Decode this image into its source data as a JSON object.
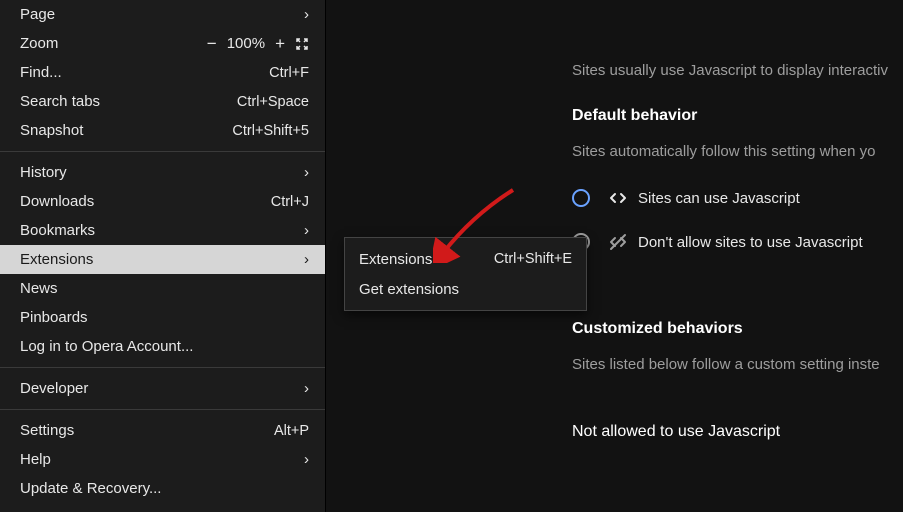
{
  "menu": {
    "page": {
      "label": "Page"
    },
    "zoom": {
      "label": "Zoom",
      "minus": "−",
      "value": "100%",
      "plus": "+"
    },
    "find": {
      "label": "Find...",
      "shortcut": "Ctrl+F"
    },
    "searchTabs": {
      "label": "Search tabs",
      "shortcut": "Ctrl+Space"
    },
    "snapshot": {
      "label": "Snapshot",
      "shortcut": "Ctrl+Shift+5"
    },
    "history": {
      "label": "History"
    },
    "downloads": {
      "label": "Downloads",
      "shortcut": "Ctrl+J"
    },
    "bookmarks": {
      "label": "Bookmarks"
    },
    "extensions": {
      "label": "Extensions"
    },
    "news": {
      "label": "News"
    },
    "pinboards": {
      "label": "Pinboards"
    },
    "login": {
      "label": "Log in to Opera Account..."
    },
    "developer": {
      "label": "Developer"
    },
    "settings": {
      "label": "Settings",
      "shortcut": "Alt+P"
    },
    "help": {
      "label": "Help"
    },
    "update": {
      "label": "Update & Recovery..."
    }
  },
  "submenu": {
    "extensions": {
      "label": "Extensions",
      "shortcut": "Ctrl+Shift+E"
    },
    "getExtensions": {
      "label": "Get extensions"
    }
  },
  "content": {
    "introDesc": "Sites usually use Javascript to display interactiv",
    "defaultBehaviorTitle": "Default behavior",
    "defaultBehaviorDesc": "Sites automatically follow this setting when yo",
    "optionAllow": "Sites can use Javascript",
    "optionDeny": "Don't allow sites to use Javascript",
    "customTitle": "Customized behaviors",
    "customDesc": "Sites listed below follow a custom setting inste",
    "notAllowedTitle": "Not allowed to use Javascript"
  }
}
